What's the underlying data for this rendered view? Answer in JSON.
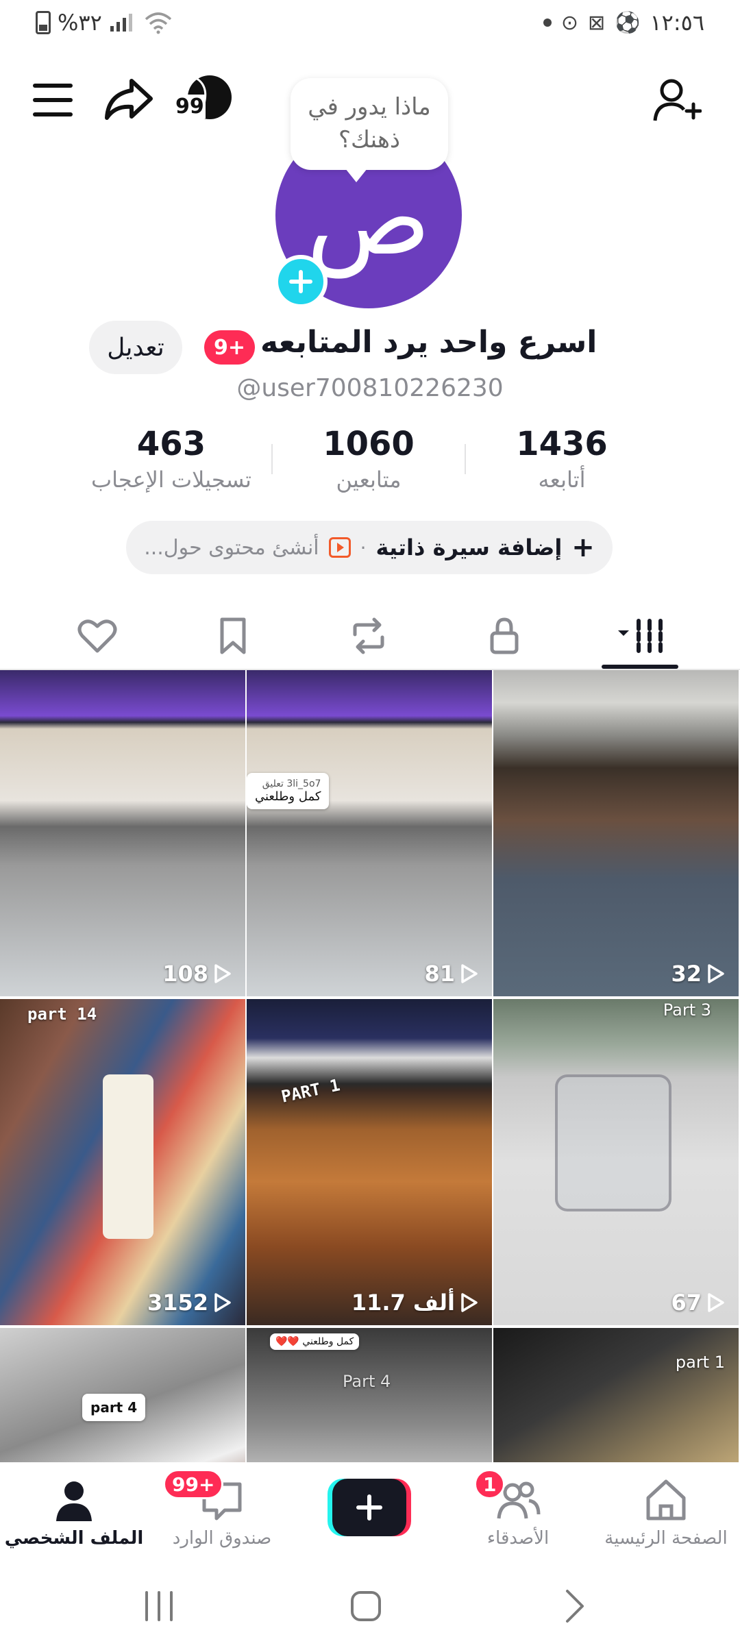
{
  "status_bar": {
    "time": "١٢:٥٦",
    "battery": "%٣٢"
  },
  "speech_bubble": {
    "text": "ماذا يدور في ذهنك؟"
  },
  "profile": {
    "avatar_letter": "ص",
    "display_name": "اسرع واحد يرد المتابعه",
    "notification_badge": "9+",
    "edit_label": "تعديل",
    "username": "@user700810226230",
    "points": "99"
  },
  "stats": {
    "following": {
      "value": "1436",
      "label": "أتابعه"
    },
    "followers": {
      "value": "1060",
      "label": "متابعين"
    },
    "likes": {
      "value": "463",
      "label": "تسجيلات الإعجاب"
    }
  },
  "bio": {
    "plus": "+",
    "add_label": "إضافة سيرة ذاتية",
    "separator": "·",
    "create_label": "أنشئ محتوى حول..."
  },
  "tabs": [
    {
      "name": "videos",
      "icon": "grid-icon",
      "active": true
    },
    {
      "name": "private",
      "icon": "lock-icon"
    },
    {
      "name": "reposts",
      "icon": "repost-icon"
    },
    {
      "name": "favorites",
      "icon": "bookmark-icon"
    },
    {
      "name": "liked",
      "icon": "heart-icon"
    }
  ],
  "videos": [
    {
      "views": "108"
    },
    {
      "views": "81",
      "comment_user": "3li_5o7 تعليق",
      "comment_text": "كمل وطلعني"
    },
    {
      "views": "32"
    },
    {
      "views": "3152",
      "part": "part 14"
    },
    {
      "views": "11.7 ألف",
      "part": "PART 1"
    },
    {
      "views": "67",
      "part": "Part 3"
    },
    {
      "part": "part 4"
    },
    {
      "part": "Part 4",
      "comment_text": "كمل وطلعني ❤️❤️"
    },
    {
      "part": "part 1"
    }
  ],
  "bottom_nav": {
    "home": "الصفحة الرئيسية",
    "friends": "الأصدقاء",
    "friends_badge": "1",
    "inbox": "صندوق الوارد",
    "inbox_badge": "99+",
    "profile": "الملف الشخصي"
  },
  "colors": {
    "accent_red": "#fe2c55",
    "accent_cyan": "#25f4ee",
    "avatar_purple": "#6b3dbd",
    "text_primary": "#161823",
    "text_secondary": "#8a8b91"
  }
}
